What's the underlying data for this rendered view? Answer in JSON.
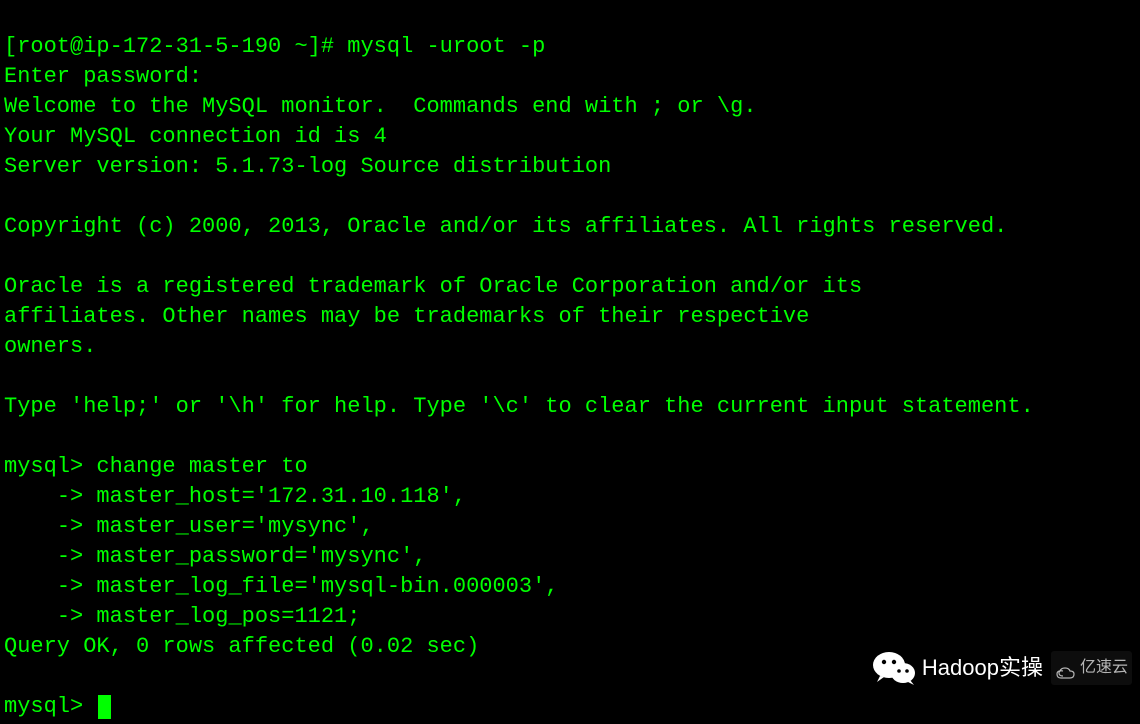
{
  "terminal": {
    "prompt": "[root@ip-172-31-5-190 ~]# ",
    "command": "mysql -uroot -p",
    "lines": [
      "Enter password: ",
      "Welcome to the MySQL monitor.  Commands end with ; or \\g.",
      "Your MySQL connection id is 4",
      "Server version: 5.1.73-log Source distribution",
      "",
      "Copyright (c) 2000, 2013, Oracle and/or its affiliates. All rights reserved.",
      "",
      "Oracle is a registered trademark of Oracle Corporation and/or its",
      "affiliates. Other names may be trademarks of their respective",
      "owners.",
      "",
      "Type 'help;' or '\\h' for help. Type '\\c' to clear the current input statement.",
      "",
      "mysql> change master to",
      "    -> master_host='172.31.10.118',",
      "    -> master_user='mysync',",
      "    -> master_password='mysync',",
      "    -> master_log_file='mysql-bin.000003',",
      "    -> master_log_pos=1121;",
      "Query OK, 0 rows affected (0.02 sec)",
      "",
      "mysql> "
    ]
  },
  "watermarks": {
    "wechat_text": "Hadoop实操",
    "yisu_text": "亿速云"
  }
}
